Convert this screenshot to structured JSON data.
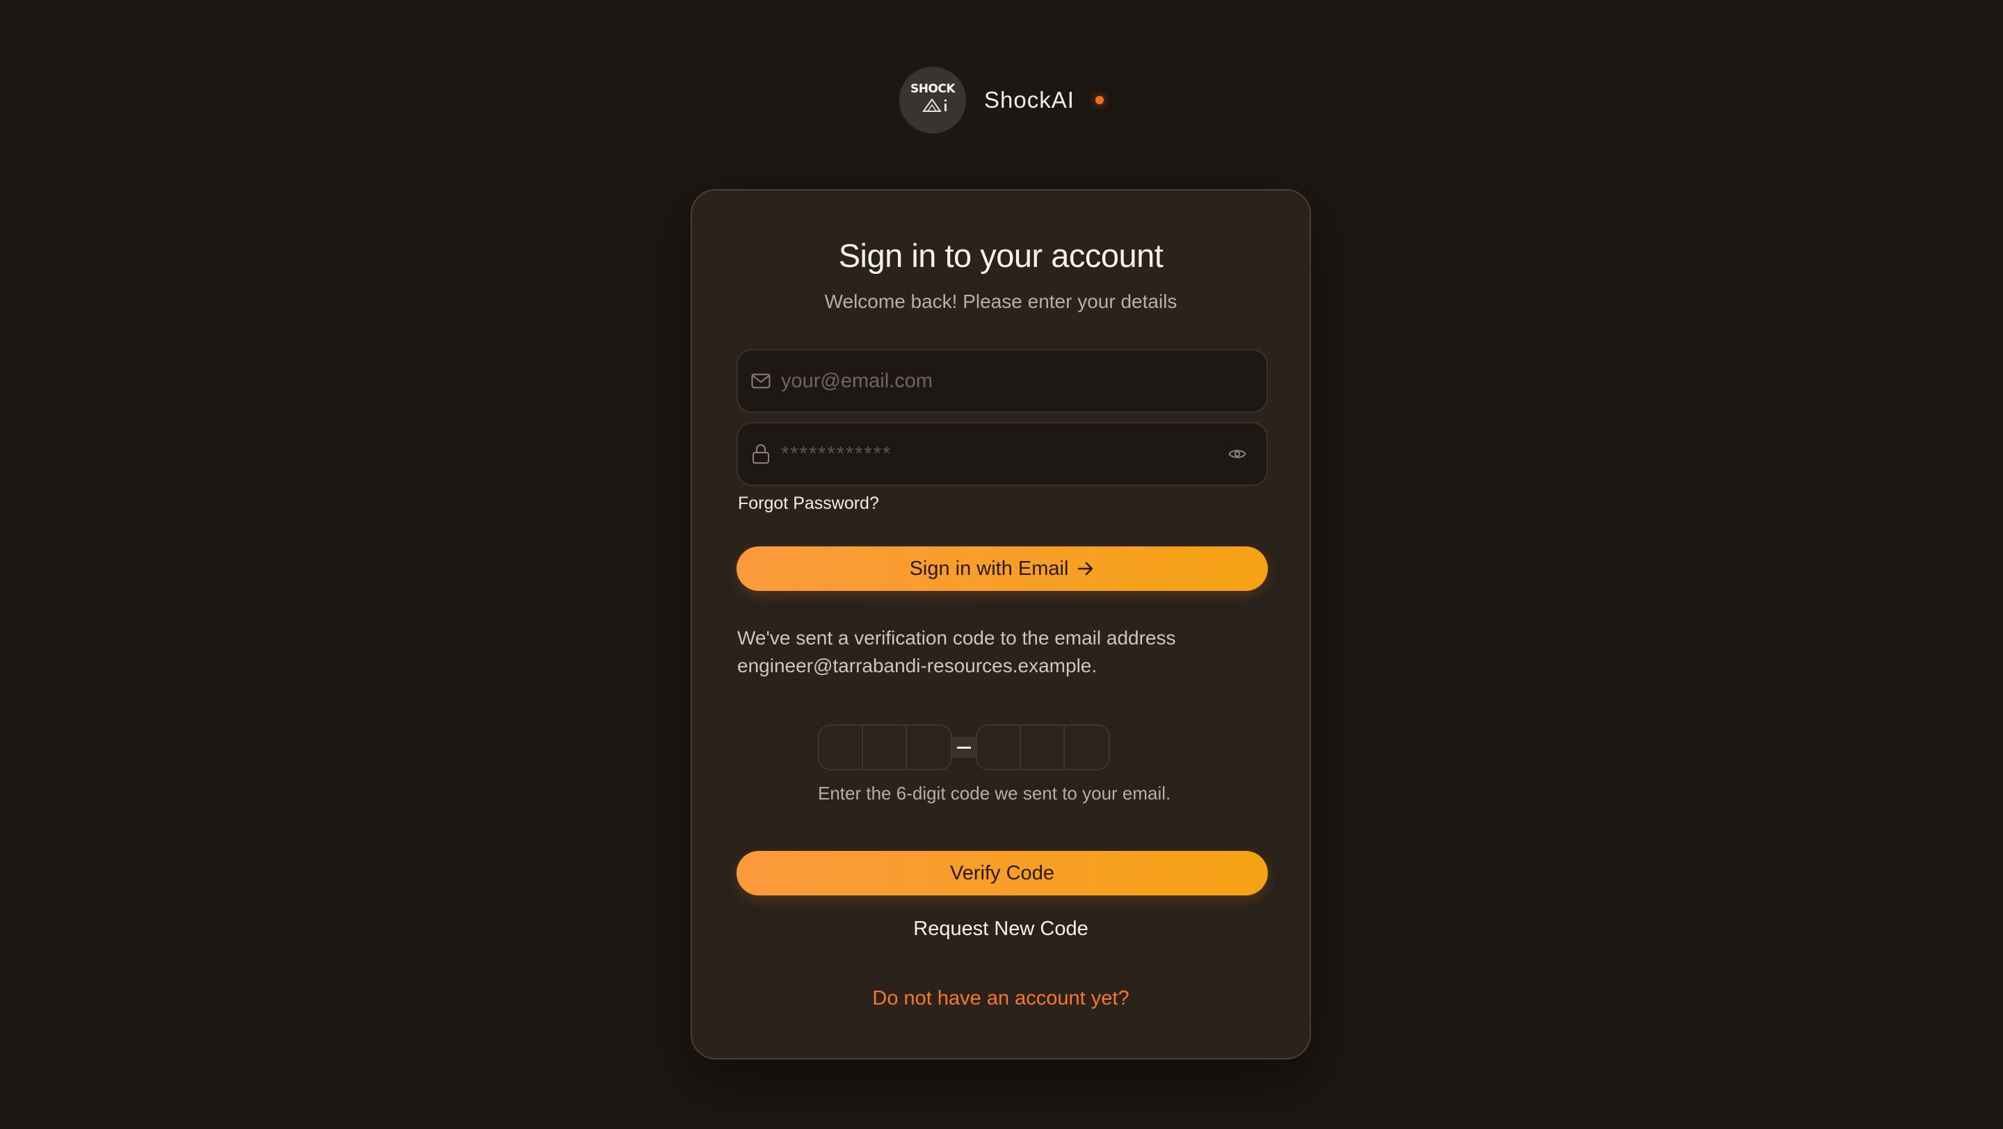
{
  "brand": {
    "logo_text_top": "SHOCK",
    "logo_text_bottom": "Ai",
    "name": "ShockAI",
    "status_color": "#f86b1a"
  },
  "card": {
    "title": "Sign in to your account",
    "subtitle": "Welcome back! Please enter your details",
    "email": {
      "icon": "mail-icon",
      "placeholder": "your@email.com",
      "value": ""
    },
    "password": {
      "icon": "lock-icon",
      "placeholder": "************",
      "value": "",
      "toggle_icon": "eye-icon"
    },
    "forgot_label": "Forgot Password?",
    "signin_label": "Sign in with Email",
    "signin_icon": "arrow-right-icon",
    "verification_message": "We've sent a verification code to the email address engineer@tarrabandi-resources.example.",
    "otp": {
      "digits": [
        "",
        "",
        "",
        "",
        "",
        ""
      ],
      "separator": "—",
      "hint": "Enter the 6-digit code we sent to your email."
    },
    "verify_label": "Verify Code",
    "request_label": "Request New Code",
    "signup_label": "Do not have an account yet?"
  },
  "colors": {
    "background": "#1c1713",
    "card": "#2a221b",
    "accent_start": "#fa9a3c",
    "accent_end": "#f5a214",
    "link_accent": "#f7782a"
  }
}
